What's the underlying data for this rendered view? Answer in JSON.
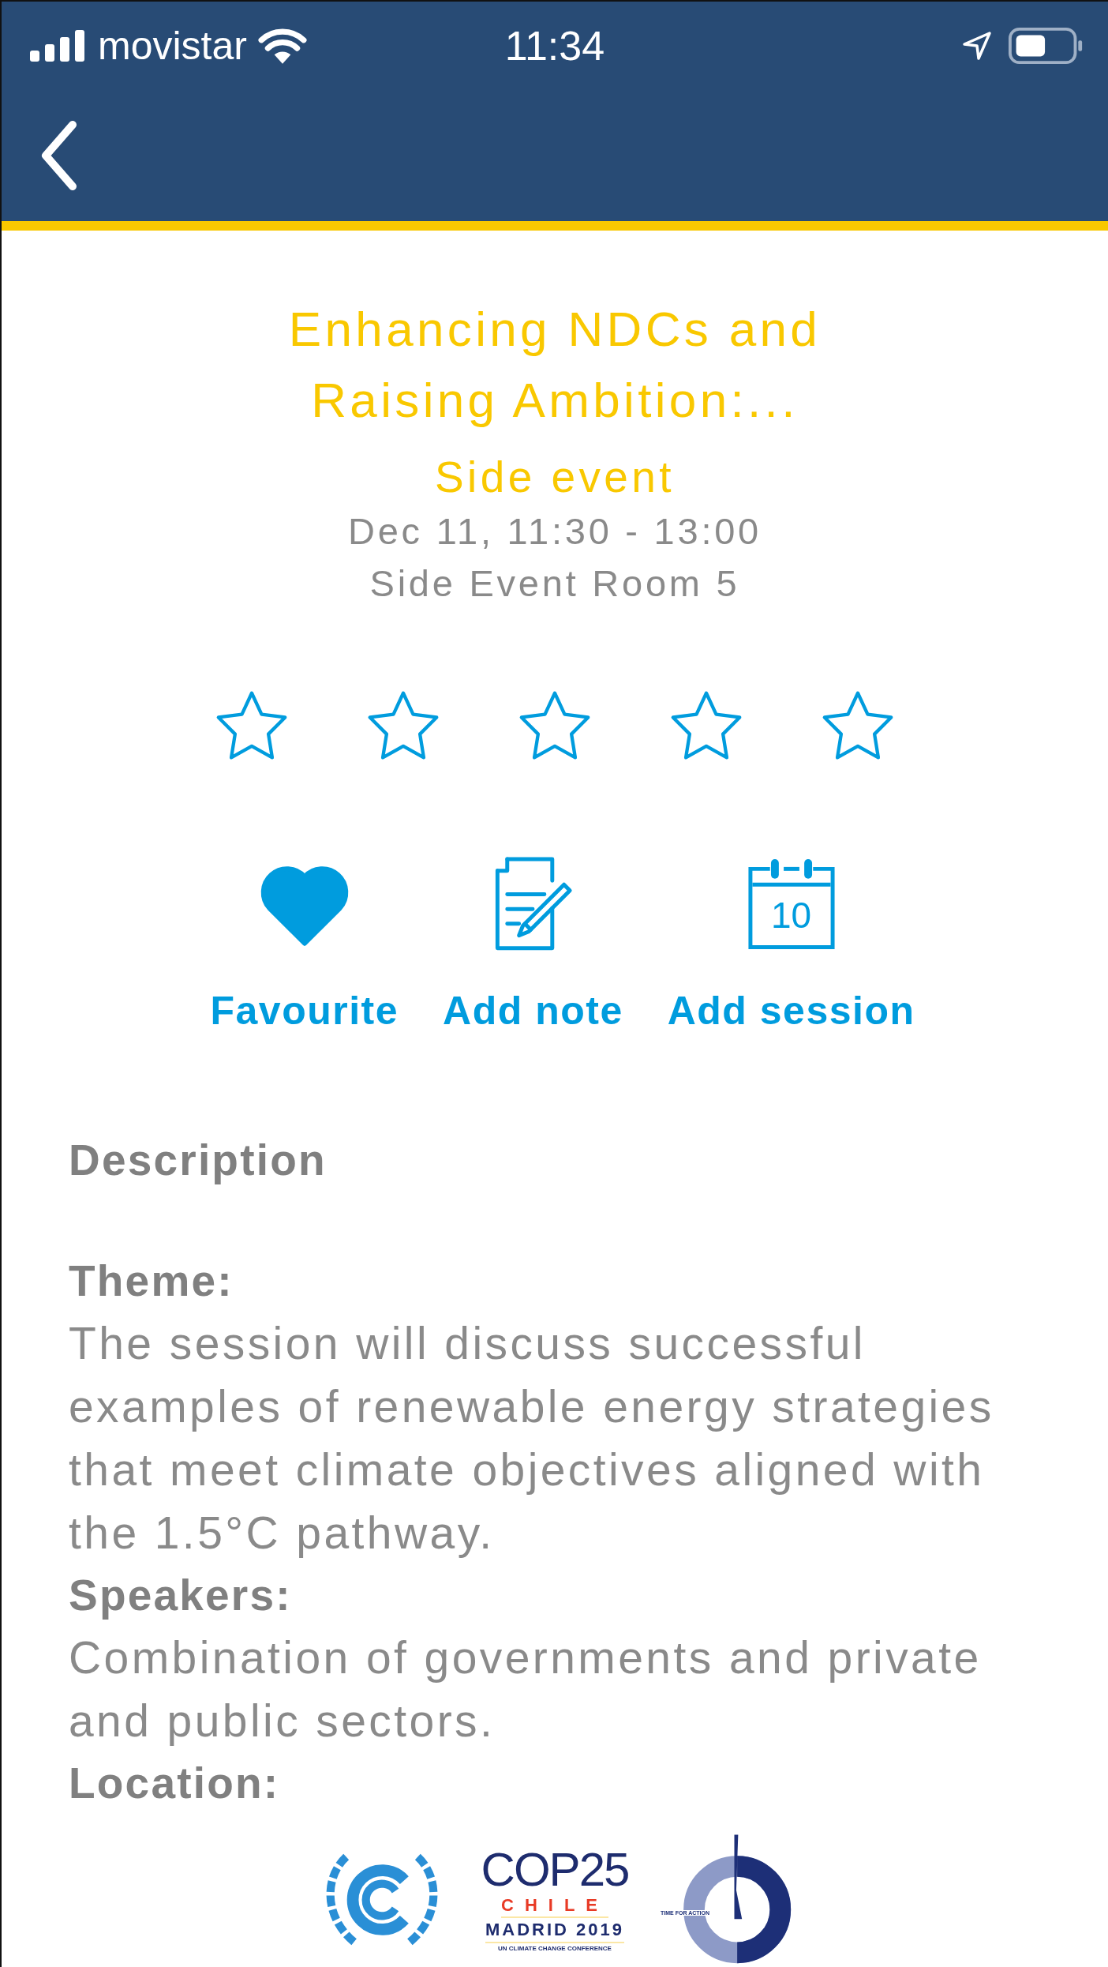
{
  "status_bar": {
    "carrier": "movistar",
    "time": "11:34"
  },
  "event": {
    "title": "Enhancing NDCs and Raising Ambition:...",
    "type": "Side event",
    "datetime": "Dec 11, 11:30 - 13:00",
    "room": "Side Event Room 5"
  },
  "rating": {
    "stars": 0
  },
  "actions": [
    {
      "kind": "favourite",
      "label": "Favourite",
      "selected": true
    },
    {
      "kind": "note",
      "label": "Add note"
    },
    {
      "kind": "calendar",
      "label": "Add session",
      "day": "10"
    }
  ],
  "description": {
    "heading": "Description",
    "sections": [
      {
        "heading": "Theme:",
        "text": "The session will discuss successful examples of renewable energy strategies that meet climate objectives aligned with the 1.5°C pathway."
      },
      {
        "heading": "Speakers:",
        "text": "Combination of governments and private and public sectors."
      },
      {
        "heading": "Location:"
      }
    ]
  },
  "logos": {
    "cop_name": "COP25",
    "country": "CHILE",
    "city_year": "MADRID 2019",
    "conference": "UN CLIMATE CHANGE CONFERENCE",
    "motto": "TIME FOR ACTION"
  }
}
